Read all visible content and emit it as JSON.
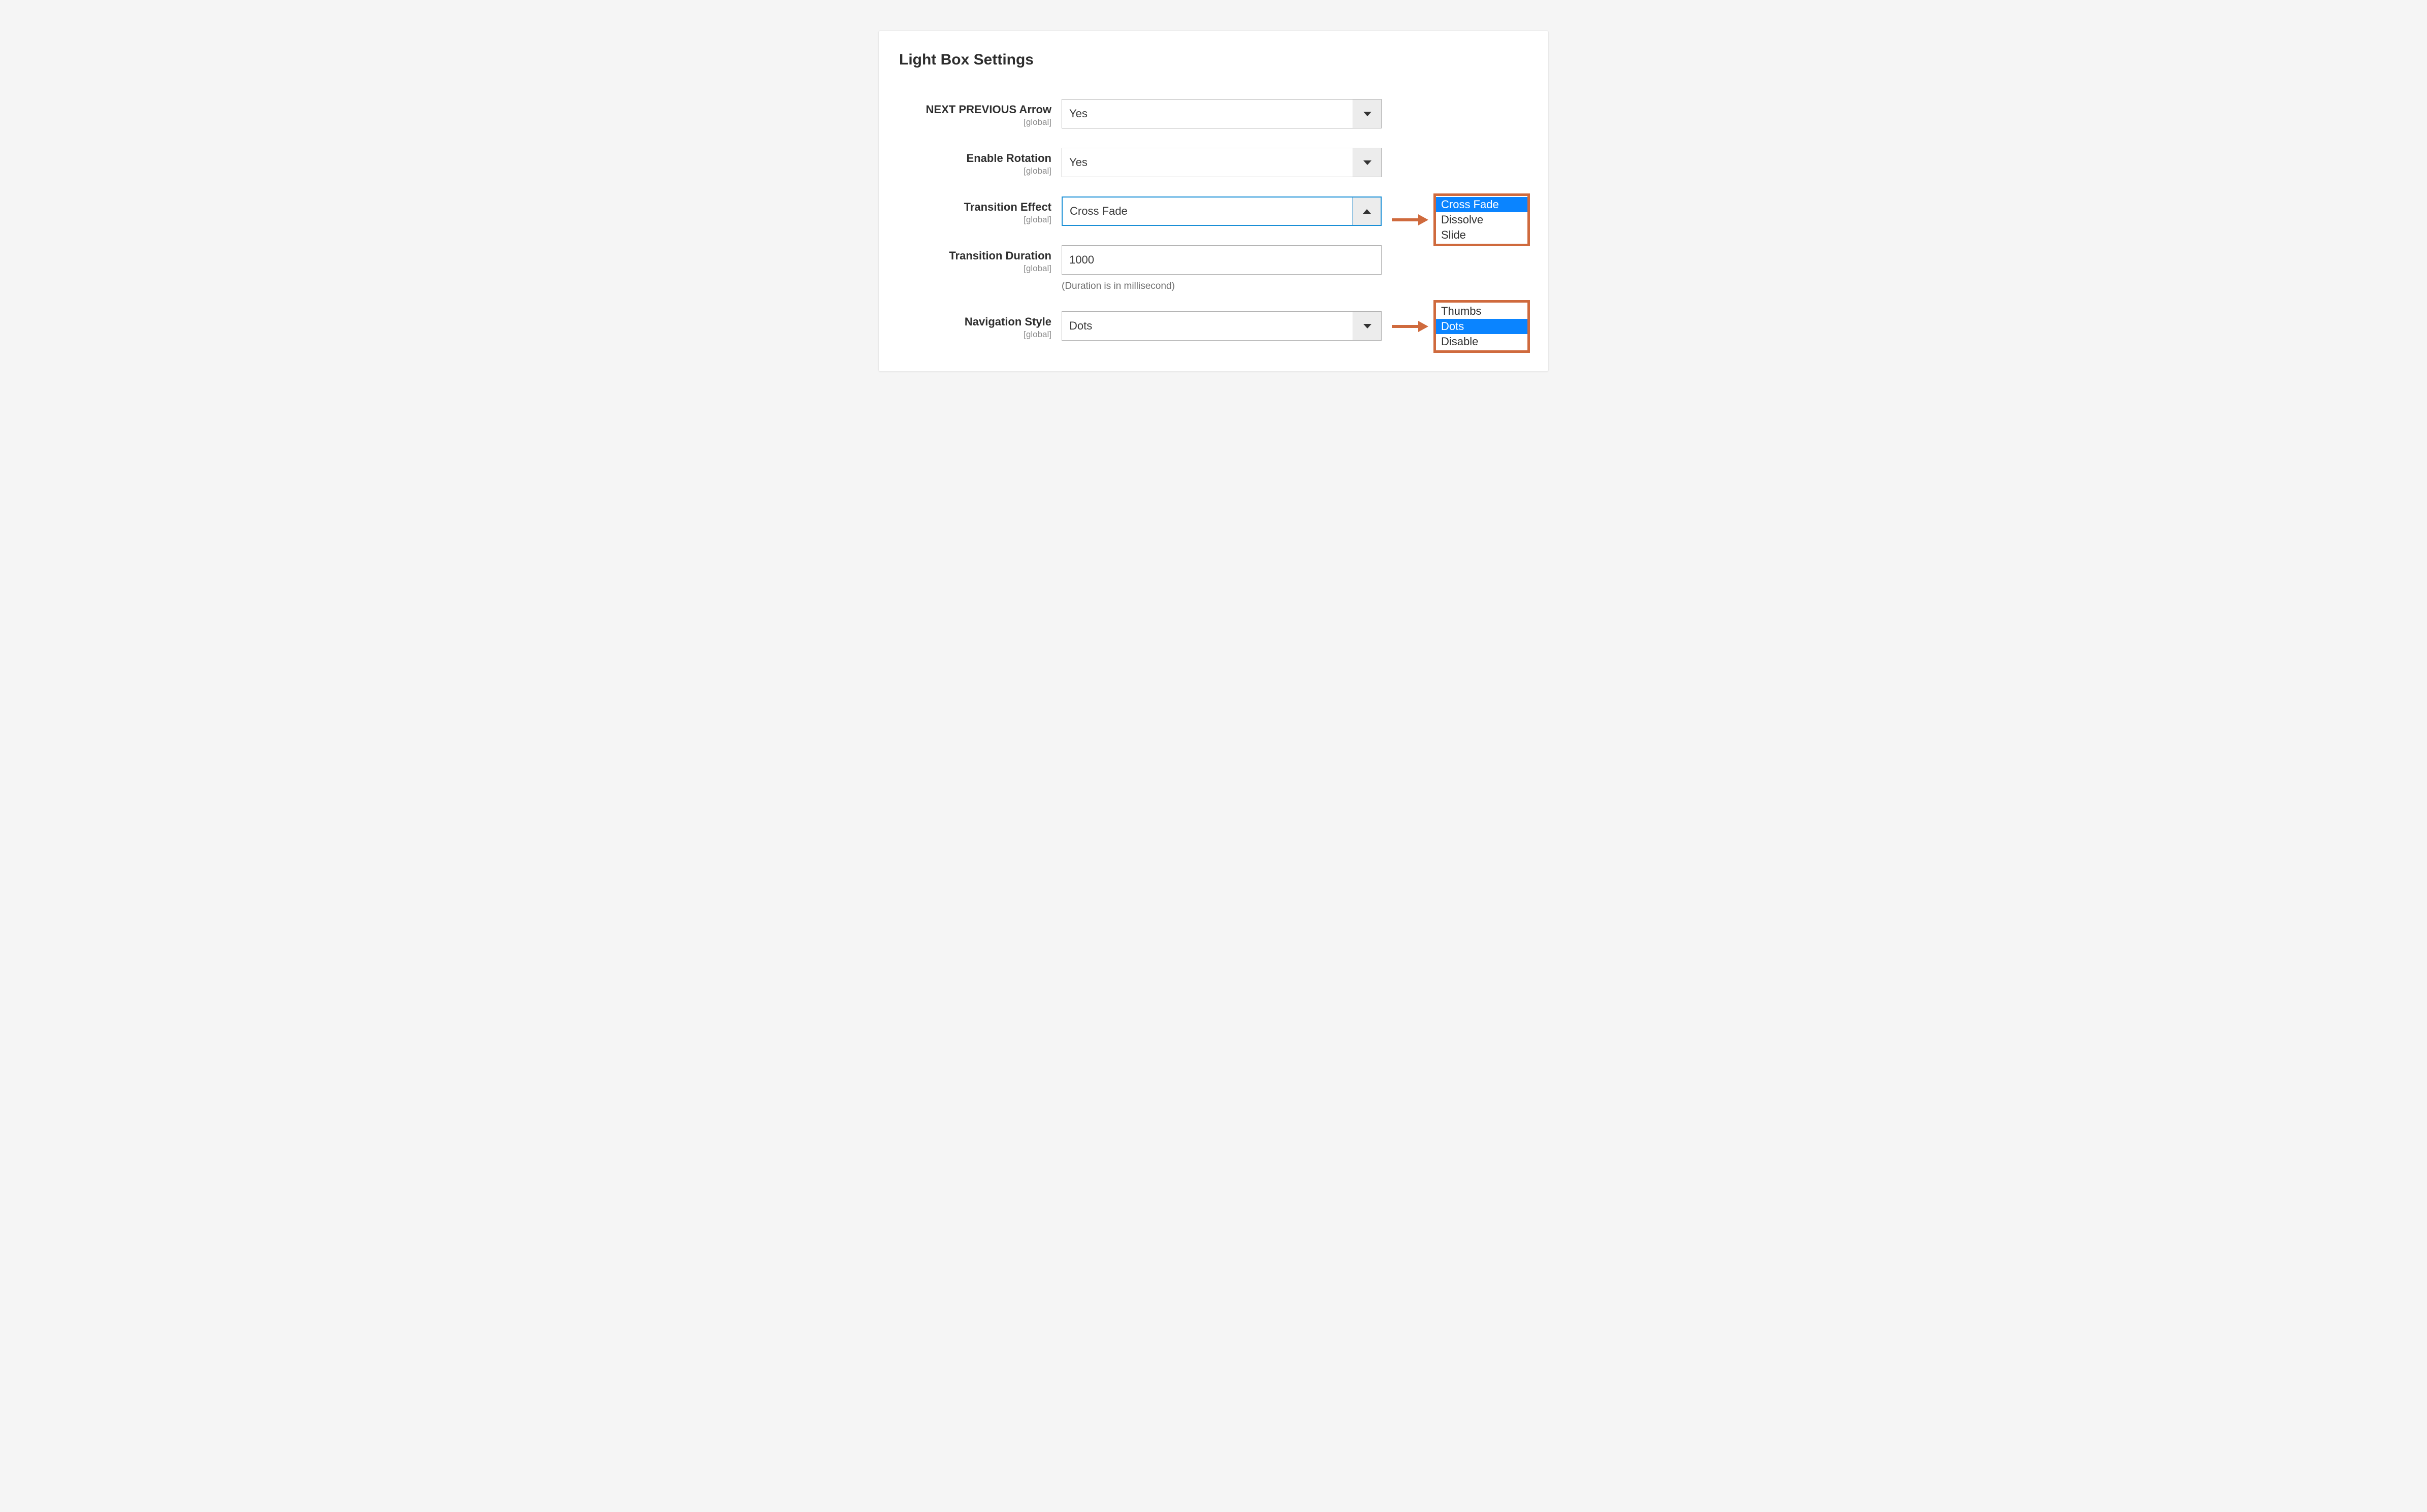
{
  "panel": {
    "title": "Light Box Settings"
  },
  "fields": {
    "next_prev_arrow": {
      "label": "NEXT PREVIOUS Arrow",
      "scope": "[global]",
      "value": "Yes"
    },
    "enable_rotation": {
      "label": "Enable Rotation",
      "scope": "[global]",
      "value": "Yes"
    },
    "transition_effect": {
      "label": "Transition Effect",
      "scope": "[global]",
      "value": "Cross Fade",
      "options": [
        "Cross Fade",
        "Dissolve",
        "Slide"
      ],
      "selected_index": 0
    },
    "transition_duration": {
      "label": "Transition Duration",
      "scope": "[global]",
      "value": "1000",
      "help": "(Duration is in millisecond)"
    },
    "navigation_style": {
      "label": "Navigation Style",
      "scope": "[global]",
      "value": "Dots",
      "options": [
        "Thumbs",
        "Dots",
        "Disable"
      ],
      "selected_index": 1
    }
  }
}
